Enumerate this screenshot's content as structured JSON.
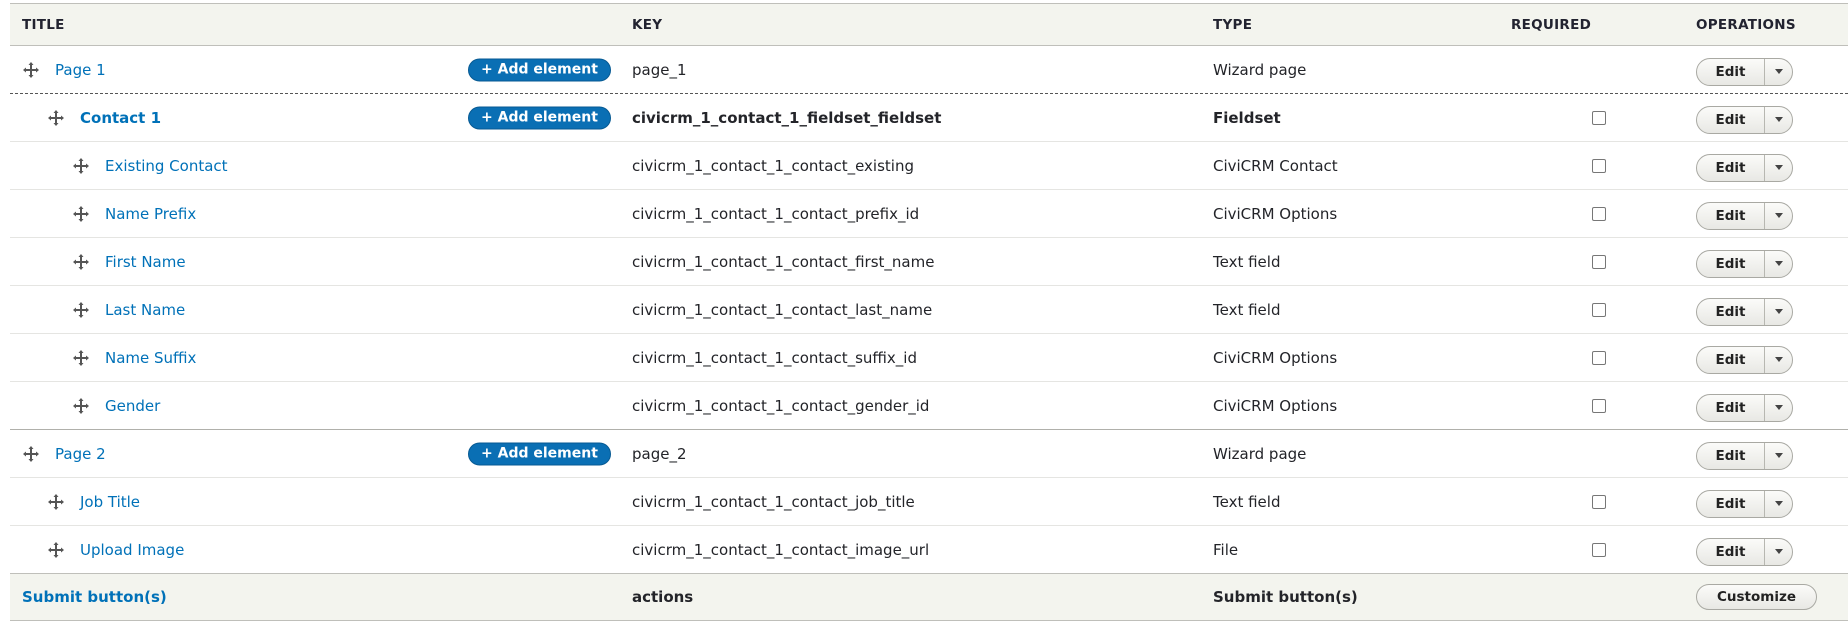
{
  "headers": {
    "title": "TITLE",
    "key": "KEY",
    "type": "TYPE",
    "required": "REQUIRED",
    "operations": "OPERATIONS"
  },
  "add_element_label": "+ Add element",
  "edit_label": "Edit",
  "rows": [
    {
      "title": "Page 1",
      "key": "page_1",
      "type": "Wizard page"
    },
    {
      "title": "Contact 1",
      "key": "civicrm_1_contact_1_fieldset_fieldset",
      "type": "Fieldset"
    },
    {
      "title": "Existing Contact",
      "key": "civicrm_1_contact_1_contact_existing",
      "type": "CiviCRM Contact"
    },
    {
      "title": "Name Prefix",
      "key": "civicrm_1_contact_1_contact_prefix_id",
      "type": "CiviCRM Options"
    },
    {
      "title": "First Name",
      "key": "civicrm_1_contact_1_contact_first_name",
      "type": "Text field"
    },
    {
      "title": "Last Name",
      "key": "civicrm_1_contact_1_contact_last_name",
      "type": "Text field"
    },
    {
      "title": "Name Suffix",
      "key": "civicrm_1_contact_1_contact_suffix_id",
      "type": "CiviCRM Options"
    },
    {
      "title": "Gender",
      "key": "civicrm_1_contact_1_contact_gender_id",
      "type": "CiviCRM Options"
    },
    {
      "title": "Page 2",
      "key": "page_2",
      "type": "Wizard page"
    },
    {
      "title": "Job Title",
      "key": "civicrm_1_contact_1_contact_job_title",
      "type": "Text field"
    },
    {
      "title": "Upload Image",
      "key": "civicrm_1_contact_1_contact_image_url",
      "type": "File"
    }
  ],
  "footer": {
    "title": "Submit button(s)",
    "key": "actions",
    "type": "Submit button(s)",
    "customize_label": "Customize"
  }
}
